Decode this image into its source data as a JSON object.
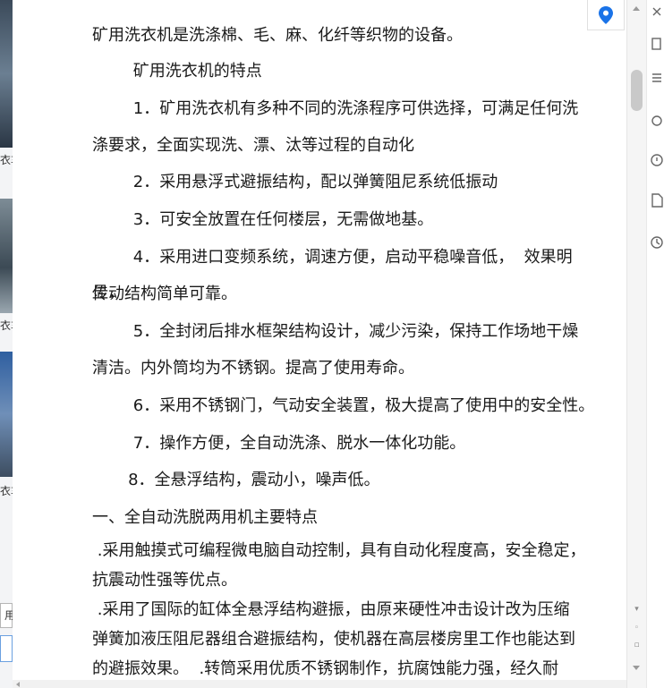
{
  "left_strip": {
    "cut_texts": [
      "衣车",
      "衣车",
      "衣车"
    ],
    "input_value": "用"
  },
  "article": {
    "paragraphs": [
      "矿用洗衣机是洗涤棉、毛、麻、化纤等织物的设备。",
      "        矿用洗衣机的特点",
      "        1．矿用洗衣机有多种不同的洗涤程序可供选择，可满足任何洗",
      "涤要求，全面实现洗、漂、汰等过程的自动化",
      "        2．采用悬浮式避振结构，配以弹簧阻尼系统低振动",
      "        3．可安全放置在任何楼层，无需做地基。",
      "        4．采用进口变频系统，调速方便，启动平稳噪音低，  效果明显，",
      "传动结构简单可靠。",
      "        5．全封闭后排水框架结构设计，减少污染，保持工作场地干燥",
      "清洁。内外筒均为不锈钢。提高了使用寿命。",
      "        6．采用不锈钢门，气动安全装置，极大提高了使用中的安全性。",
      "        7．操作方便，全自动洗涤、脱水一体化功能。",
      "       8．全悬浮结构，震动小，噪声低。",
      "一、全自动洗脱两用机主要特点",
      " .采用触摸式可编程微电脑自动控制，具有自动化程度高，安全稳定，",
      "抗震动性强等优点。",
      " .采用了国际的缸体全悬浮结构避振，由原来硬性冲击设计改为压缩",
      "弹簧加液压阻尼器组合避振结构，使机器在高层楼房里工作也能达到",
      "的避振效果。  .转筒采用优质不锈钢制作，抗腐蚀能力强，经久耐"
    ]
  },
  "colors": {
    "accent": "#1a73e8",
    "text": "#1a1a1a"
  },
  "icons": {
    "location": "location-pin-icon",
    "toolbar": [
      "tool-x-icon",
      "tool-copy-icon",
      "tool-help-icon",
      "tool-doc-icon",
      "tool-clock-icon"
    ]
  }
}
